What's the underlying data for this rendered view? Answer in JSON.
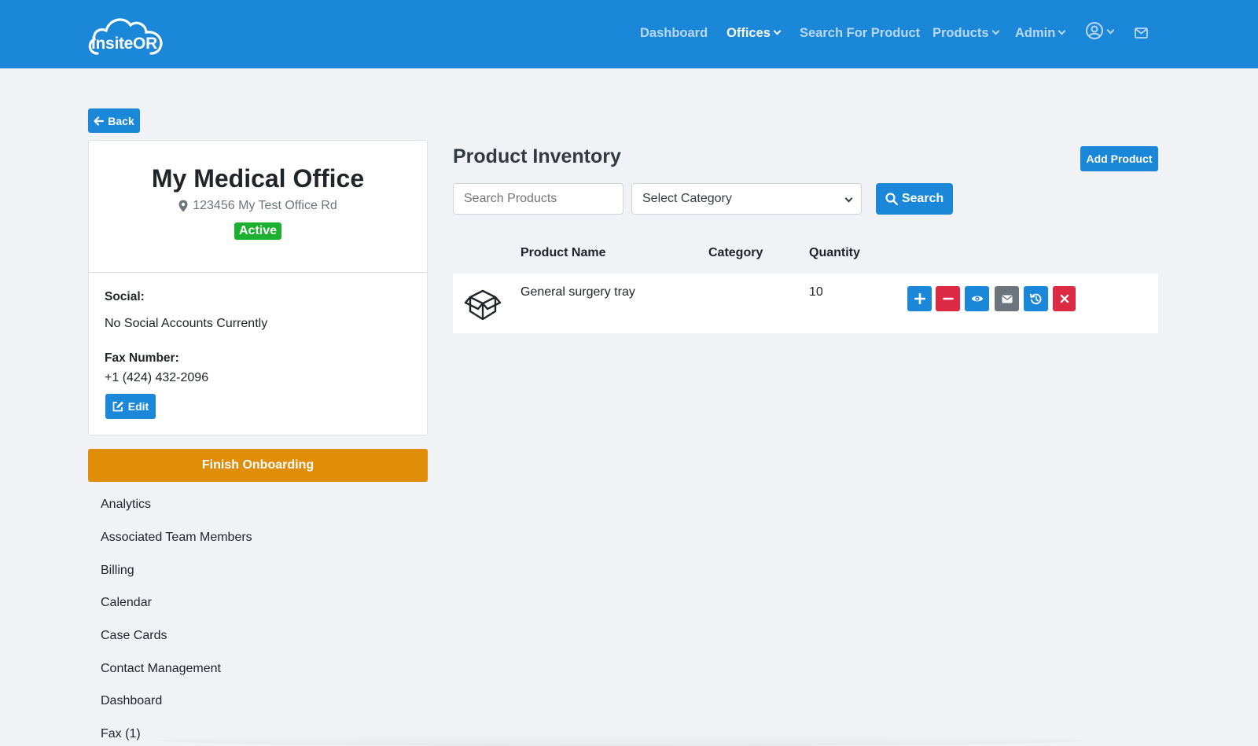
{
  "header": {
    "logo_text": "insiteOR",
    "nav": [
      {
        "label": "Dashboard"
      },
      {
        "label": "Offices"
      },
      {
        "label": "Search For Product"
      },
      {
        "label": "Products"
      },
      {
        "label": "Admin"
      }
    ],
    "icons": [
      "user-circle-icon",
      "mail-icon"
    ]
  },
  "back_label": "Back",
  "office": {
    "name": "My Medical Office",
    "address": "123456 My Test Office Rd",
    "status": "Active",
    "social_label": "Social:",
    "social_value": "No Social Accounts Currently",
    "fax_label": "Fax Number:",
    "fax_value": "+1 (424) 432-2096",
    "edit_label": "Edit"
  },
  "finish_onboarding_label": "Finish Onboarding",
  "sidebar": {
    "items": [
      {
        "label": "Analytics"
      },
      {
        "label": "Associated Team Members"
      },
      {
        "label": "Billing"
      },
      {
        "label": "Calendar"
      },
      {
        "label": "Case Cards"
      },
      {
        "label": "Contact Management"
      },
      {
        "label": "Dashboard"
      },
      {
        "label": "Fax (1)"
      }
    ]
  },
  "inventory": {
    "title": "Product Inventory",
    "add_product_label": "Add Product",
    "search_placeholder": "Search Products",
    "category_selected": "Select Category",
    "search_button": "Search",
    "columns": [
      "Product Name",
      "Category",
      "Quantity"
    ],
    "rows": [
      {
        "name": "General surgery tray",
        "category": "",
        "quantity": "10"
      }
    ]
  },
  "colors": {
    "primary": "#1a87d9",
    "danger": "#dc2a45",
    "secondary": "#6c757d",
    "success": "#1bb02f",
    "warning": "#e08d0a"
  }
}
